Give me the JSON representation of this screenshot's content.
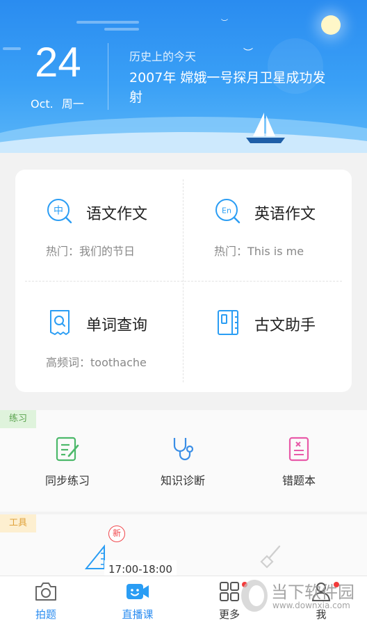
{
  "header": {
    "day": "24",
    "month": "Oct.",
    "weekday": "周一",
    "history_label": "历史上的今天",
    "history_text": "2007年 嫦娥一号探月卫星成功发射"
  },
  "tools": [
    {
      "name": "语文作文",
      "sub": "热门：我们的节日",
      "icon": "chinese-char-search-icon",
      "icon_text": "中"
    },
    {
      "name": "英语作文",
      "sub": "热门：This is me",
      "icon": "english-search-icon",
      "icon_text": "En"
    },
    {
      "name": "单词查询",
      "sub": "高频词：toothache",
      "icon": "word-lookup-icon"
    },
    {
      "name": "古文助手",
      "sub": "",
      "icon": "classical-book-icon"
    }
  ],
  "practice": {
    "tag": "练习",
    "items": [
      {
        "label": "同步练习",
        "icon": "edit-note-icon",
        "color": "#4cb86a"
      },
      {
        "label": "知识诊断",
        "icon": "stethoscope-icon",
        "color": "#3a8ee6"
      },
      {
        "label": "错题本",
        "icon": "wrong-book-icon",
        "color": "#e85aa8"
      }
    ]
  },
  "toolsec": {
    "tag": "工具",
    "new_badge": "新",
    "live_time": "17:00-18:00"
  },
  "nav": {
    "items": [
      {
        "label": "拍题",
        "icon": "camera-icon",
        "active": true
      },
      {
        "label": "直播课",
        "icon": "live-video-icon",
        "active": false
      },
      {
        "label": "更多",
        "icon": "grid-more-icon",
        "active": false
      },
      {
        "label": "我",
        "icon": "user-icon",
        "active": false
      }
    ]
  },
  "watermark": {
    "brand": "当下软件园",
    "url": "www.downxia.com"
  },
  "colors": {
    "accent": "#2a8cf0",
    "badge_red": "#f23b3b"
  }
}
